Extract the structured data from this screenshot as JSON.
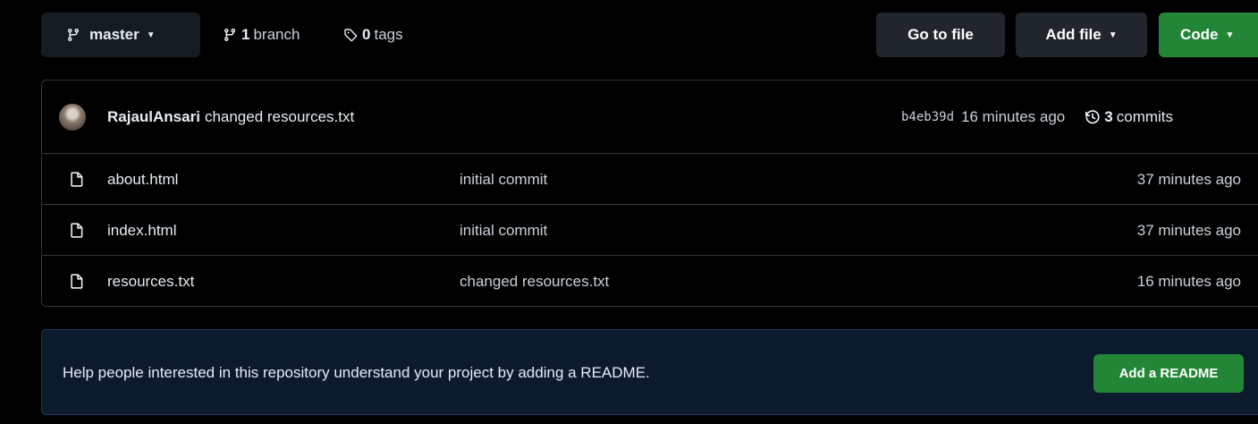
{
  "toolbar": {
    "branch_name": "master",
    "branch_count": "1",
    "branch_label": "branch",
    "tag_count": "0",
    "tag_label": "tags",
    "go_to_file_label": "Go to file",
    "add_file_label": "Add file",
    "code_label": "Code"
  },
  "latest_commit": {
    "author": "RajaulAnsari",
    "message": "changed resources.txt",
    "sha": "b4eb39d",
    "time": "16 minutes ago",
    "commit_count": "3",
    "commit_label": "commits"
  },
  "files": [
    {
      "name": "about.html",
      "message": "initial commit",
      "time": "37 minutes ago"
    },
    {
      "name": "index.html",
      "message": "initial commit",
      "time": "37 minutes ago"
    },
    {
      "name": "resources.txt",
      "message": "changed resources.txt",
      "time": "16 minutes ago"
    }
  ],
  "readme": {
    "prompt": "Help people interested in this repository understand your project by adding a README.",
    "button_label": "Add a README"
  },
  "colors": {
    "background": "#000000",
    "button_dark": "#21262d",
    "button_green": "#238636",
    "border": "#30363d",
    "banner_bg": "#0c1a2e"
  },
  "icons": {
    "branch": "git-branch-icon",
    "tag": "tag-icon",
    "history": "history-icon",
    "file": "file-icon"
  }
}
